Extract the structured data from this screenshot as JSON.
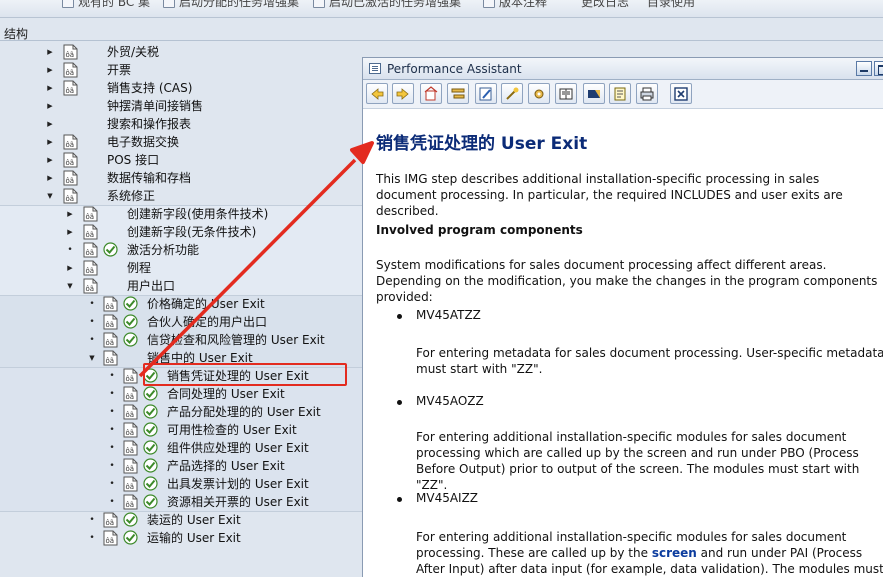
{
  "toolbar": {
    "items": [
      "观有的 BC 集",
      "启动分配的任务增强集",
      "启动已激活的任务增强集",
      "版本注释",
      "更改日志",
      "目录使用"
    ]
  },
  "structure_label": "结构",
  "tree": {
    "rows": [
      {
        "label": "外贸/关税"
      },
      {
        "label": "开票"
      },
      {
        "label": "销售支持 (CAS)"
      },
      {
        "label": "钟摆清单间接销售"
      },
      {
        "label": "搜索和操作报表"
      },
      {
        "label": "电子数据交换"
      },
      {
        "label": "POS 接口"
      },
      {
        "label": "数据传输和存档"
      },
      {
        "label": "系统修正"
      },
      {
        "label": "创建新字段(使用条件技术)"
      },
      {
        "label": "创建新字段(无条件技术)"
      },
      {
        "label": "激活分析功能"
      },
      {
        "label": "例程"
      },
      {
        "label": "用户出口"
      },
      {
        "label": "价格确定的 User Exit"
      },
      {
        "label": "合伙人确定的用户出口"
      },
      {
        "label": "信贷检查和风险管理的 User Exit"
      },
      {
        "label": "销售中的 User Exit"
      },
      {
        "label": "销售凭证处理的 User Exit"
      },
      {
        "label": "合同处理的 User Exit"
      },
      {
        "label": "产品分配处理的的 User Exit"
      },
      {
        "label": "可用性检查的 User Exit"
      },
      {
        "label": "组件供应处理的 User Exit"
      },
      {
        "label": "产品选择的 User Exit"
      },
      {
        "label": "出具发票计划的 User Exit"
      },
      {
        "label": "资源相关开票的 User Exit"
      },
      {
        "label": "装运的 User Exit"
      },
      {
        "label": "运输的 User Exit"
      }
    ]
  },
  "assistant": {
    "title": "Performance Assistant",
    "heading": "销售凭证处理的  User Exit",
    "intro": "This IMG step describes additional installation-specific processing in sales document processing. In particular, the required INCLUDES and user exits are described.",
    "section_title": "Involved program components",
    "section_intro": "System modifications for sales document processing affect different areas. Depending on the modification, you make the changes in the program components provided:",
    "items": [
      {
        "name": "MV45ATZZ",
        "desc": "For entering metadata for sales document processing. User-specific metadata must start with \"ZZ\"."
      },
      {
        "name": "MV45AOZZ",
        "desc": "For entering additional installation-specific modules for sales document processing which are called up by the screen and run under PBO (Process Before Output) prior to output of the screen. The modules must start with \"ZZ\"."
      },
      {
        "name": "MV45AIZZ",
        "desc_before": "For entering additional installation-specific modules for sales document processing. These are called up by the ",
        "desc_link": "screen",
        "desc_after": " and run under PAI (Process After Input) after data input (for example, data validation). The modules must start with"
      }
    ]
  },
  "colors": {
    "heading": "#0b2b77",
    "highlight": "#e32b1f",
    "arrow": "#e32b1f",
    "link": "#0b3c9e"
  }
}
